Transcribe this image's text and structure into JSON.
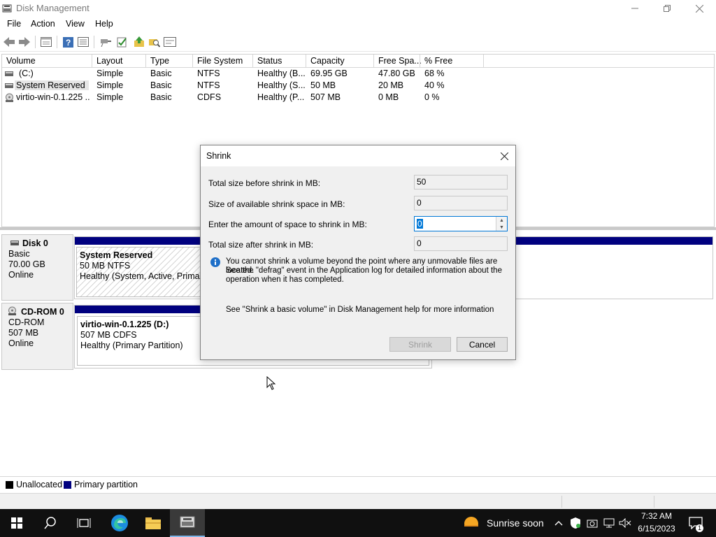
{
  "window": {
    "title": "Disk Management"
  },
  "menu": [
    "File",
    "Action",
    "View",
    "Help"
  ],
  "toolbar": {
    "icons": [
      "back-icon",
      "forward-icon",
      "properties-icon",
      "help-icon",
      "list-icon",
      "connect-icon",
      "check-icon",
      "folder-up-icon",
      "search-folder-icon",
      "console-icon"
    ]
  },
  "volume_list": {
    "columns": [
      "Volume",
      "Layout",
      "Type",
      "File System",
      "Status",
      "Capacity",
      "Free Spa...",
      "% Free"
    ],
    "rows": [
      {
        "volume": "(C:)",
        "layout": "Simple",
        "type": "Basic",
        "fs": "NTFS",
        "status": "Healthy (B...",
        "capacity": "69.95 GB",
        "free": "47.80 GB",
        "pct": "68 %"
      },
      {
        "volume": "System Reserved",
        "layout": "Simple",
        "type": "Basic",
        "fs": "NTFS",
        "status": "Healthy (S...",
        "capacity": "50 MB",
        "free": "20 MB",
        "pct": "40 %"
      },
      {
        "volume": "virtio-win-0.1.225 ...",
        "layout": "Simple",
        "type": "Basic",
        "fs": "CDFS",
        "status": "Healthy (P...",
        "capacity": "507 MB",
        "free": "0 MB",
        "pct": "0 %"
      }
    ]
  },
  "disks": [
    {
      "name": "Disk 0",
      "type": "Basic",
      "size": "70.00 GB",
      "state": "Online",
      "partition": {
        "name": "System Reserved",
        "detail": "50 MB NTFS",
        "status": "Healthy (System, Active, Primary"
      }
    },
    {
      "name": "CD-ROM 0",
      "type": "CD-ROM",
      "size": "507 MB",
      "state": "Online",
      "partition": {
        "name": "virtio-win-0.1.225  (D:)",
        "detail": "507 MB CDFS",
        "status": "Healthy (Primary Partition)"
      }
    }
  ],
  "legend": [
    {
      "label": "Unallocated",
      "color": "#000000"
    },
    {
      "label": "Primary partition",
      "color": "#00007f"
    }
  ],
  "dialog": {
    "title": "Shrink",
    "total_before_label": "Total size before shrink in MB:",
    "total_before_value": "50",
    "available_label": "Size of available shrink space in MB:",
    "available_value": "0",
    "amount_label": "Enter the amount of space to shrink in MB:",
    "amount_value": "0",
    "total_after_label": "Total size after shrink in MB:",
    "total_after_value": "0",
    "info_text_1": "You cannot shrink a volume beyond the point where any unmovable files are located.",
    "info_text_2": "See the \"defrag\" event in the Application log for detailed information about the",
    "info_text_3": "operation when it has completed.",
    "help_text": "See \"Shrink a basic volume\" in Disk Management help for more information",
    "shrink_label": "Shrink",
    "cancel_label": "Cancel"
  },
  "taskbar": {
    "weather": "Sunrise soon",
    "time": "7:32 AM",
    "date": "6/15/2023",
    "notification_count": "1"
  },
  "colors": {
    "primary_partition": "#00007f",
    "accent": "#0078d7",
    "taskbar": "#101010"
  }
}
